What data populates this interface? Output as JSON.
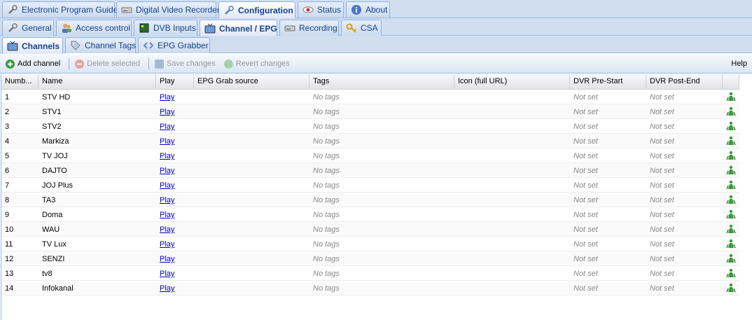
{
  "main_tabs": [
    {
      "label": "Electronic Program Guide",
      "icon": "wrench-icon"
    },
    {
      "label": "Digital Video Recorder",
      "icon": "drive-icon"
    },
    {
      "label": "Configuration",
      "icon": "wrench-icon"
    },
    {
      "label": "Status",
      "icon": "eye-icon"
    },
    {
      "label": "About",
      "icon": "info-icon"
    }
  ],
  "config_tabs": [
    {
      "label": "General",
      "icon": "wrench-icon"
    },
    {
      "label": "Access control",
      "icon": "users-icon"
    },
    {
      "label": "DVB Inputs",
      "icon": "card-icon"
    },
    {
      "label": "Channel / EPG",
      "icon": "tv-icon"
    },
    {
      "label": "Recording",
      "icon": "drive-icon"
    },
    {
      "label": "CSA",
      "icon": "key-icon"
    }
  ],
  "channel_tabs": [
    {
      "label": "Channels",
      "icon": "tv-icon"
    },
    {
      "label": "Channel Tags",
      "icon": "tag-icon"
    },
    {
      "label": "EPG Grabber",
      "icon": "code-icon"
    }
  ],
  "toolbar": {
    "add": "Add channel",
    "delete": "Delete selected",
    "save": "Save changes",
    "revert": "Revert changes",
    "help": "Help"
  },
  "columns": [
    "Numb...",
    "Name",
    "Play",
    "EPG Grab source",
    "Tags",
    "Icon (full URL)",
    "DVR Pre-Start",
    "DVR Post-End"
  ],
  "rows": [
    {
      "num": "1",
      "name": "STV HD",
      "play": "Play",
      "tags": "No tags",
      "pre": "Not set",
      "post": "Not set"
    },
    {
      "num": "2",
      "name": "STV1",
      "play": "Play",
      "tags": "No tags",
      "pre": "Not set",
      "post": "Not set"
    },
    {
      "num": "3",
      "name": "STV2",
      "play": "Play",
      "tags": "No tags",
      "pre": "Not set",
      "post": "Not set"
    },
    {
      "num": "4",
      "name": "Markiza",
      "play": "Play",
      "tags": "No tags",
      "pre": "Not set",
      "post": "Not set"
    },
    {
      "num": "5",
      "name": "TV JOJ",
      "play": "Play",
      "tags": "No tags",
      "pre": "Not set",
      "post": "Not set"
    },
    {
      "num": "6",
      "name": "DAJTO",
      "play": "Play",
      "tags": "No tags",
      "pre": "Not set",
      "post": "Not set"
    },
    {
      "num": "7",
      "name": "JOJ Plus",
      "play": "Play",
      "tags": "No tags",
      "pre": "Not set",
      "post": "Not set"
    },
    {
      "num": "8",
      "name": "TA3",
      "play": "Play",
      "tags": "No tags",
      "pre": "Not set",
      "post": "Not set"
    },
    {
      "num": "9",
      "name": "Doma",
      "play": "Play",
      "tags": "No tags",
      "pre": "Not set",
      "post": "Not set"
    },
    {
      "num": "10",
      "name": "WAU",
      "play": "Play",
      "tags": "No tags",
      "pre": "Not set",
      "post": "Not set"
    },
    {
      "num": "11",
      "name": "TV Lux",
      "play": "Play",
      "tags": "No tags",
      "pre": "Not set",
      "post": "Not set"
    },
    {
      "num": "12",
      "name": "SENZI",
      "play": "Play",
      "tags": "No tags",
      "pre": "Not set",
      "post": "Not set"
    },
    {
      "num": "13",
      "name": "tv8",
      "play": "Play",
      "tags": "No tags",
      "pre": "Not set",
      "post": "Not set"
    },
    {
      "num": "14",
      "name": "Infokanal",
      "play": "Play",
      "tags": "No tags",
      "pre": "Not set",
      "post": "Not set"
    }
  ]
}
